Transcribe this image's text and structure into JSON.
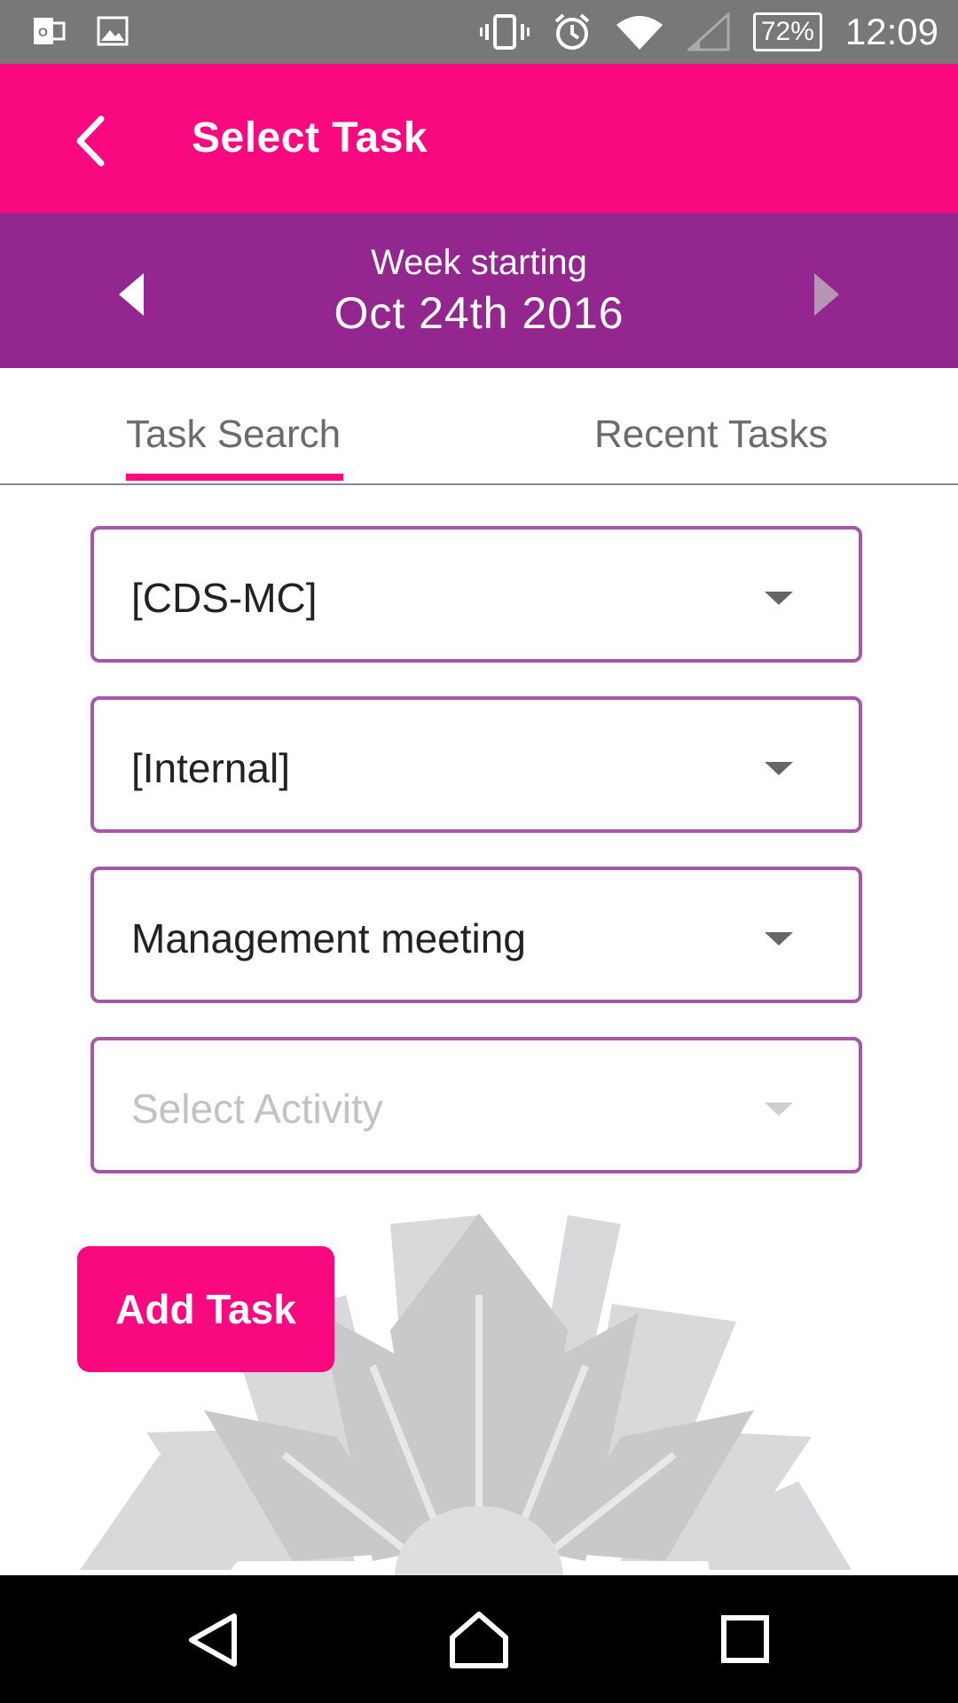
{
  "status_bar": {
    "left_icons": [
      "outlook-icon",
      "image-icon"
    ],
    "right_icons": [
      "vibrate-icon",
      "alarm-icon",
      "wifi-icon",
      "signal-icon"
    ],
    "battery": "72%",
    "time": "12:09"
  },
  "app_bar": {
    "title": "Select Task",
    "back_icon": "chevron-left-icon"
  },
  "week": {
    "label": "Week starting",
    "date": "Oct 24th 2016"
  },
  "tabs": [
    {
      "label": "Task Search",
      "active": true
    },
    {
      "label": "Recent Tasks",
      "active": false
    }
  ],
  "fields": [
    {
      "value": "[CDS-MC]",
      "placeholder": ""
    },
    {
      "value": "[Internal]",
      "placeholder": ""
    },
    {
      "value": "Management meeting",
      "placeholder": ""
    },
    {
      "value": "",
      "placeholder": "Select Activity"
    }
  ],
  "add_task_label": "Add Task",
  "colors": {
    "primary": "#f9087f",
    "secondary": "#93278f",
    "field_border": "#a658a8"
  },
  "nav_bar": [
    "back-icon",
    "home-icon",
    "recents-icon"
  ]
}
